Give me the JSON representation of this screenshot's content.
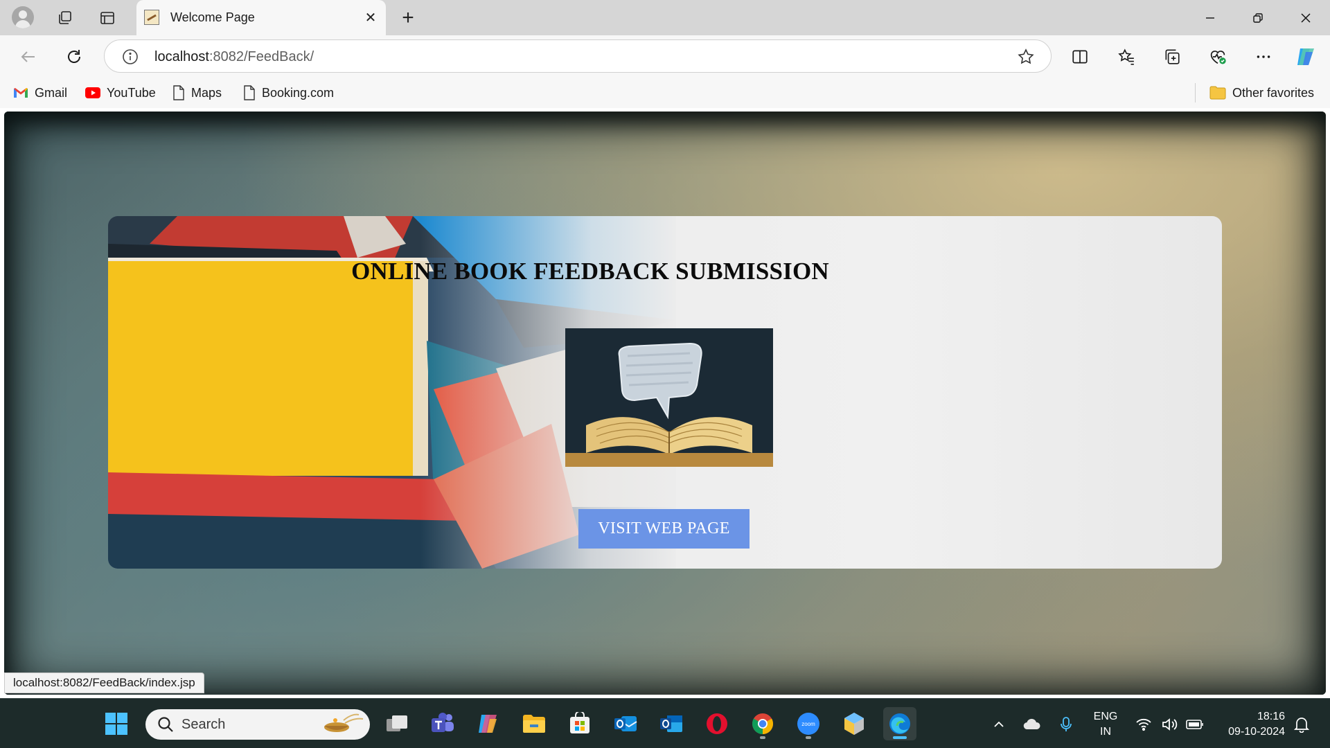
{
  "browser": {
    "tab": {
      "title": "Welcome Page"
    },
    "address": {
      "host": "localhost",
      "path": ":8082/FeedBack/"
    },
    "bookmarks": [
      {
        "label": "Gmail",
        "icon": "gmail-icon"
      },
      {
        "label": "YouTube",
        "icon": "youtube-icon"
      },
      {
        "label": "Maps",
        "icon": "page-icon"
      },
      {
        "label": "Booking.com",
        "icon": "page-icon"
      }
    ],
    "other_favorites": "Other favorites",
    "status_url": "localhost:8082/FeedBack/index.jsp"
  },
  "page": {
    "title": "ONLINE BOOK FEEDBACK SUBMISSION",
    "button_label": "VISIT WEB PAGE",
    "button_color": "#6b94e6"
  },
  "taskbar": {
    "search_label": "Search",
    "language": "ENG",
    "region": "IN",
    "time": "18:16",
    "date": "09-10-2024",
    "apps": [
      "start-icon",
      "task-view-icon",
      "teams-icon",
      "copilot-icon",
      "file-explorer-icon",
      "microsoft-store-icon",
      "outlook-new-icon",
      "outlook-icon",
      "opera-icon",
      "chrome-icon",
      "zoom-icon",
      "app-icon",
      "edge-icon"
    ]
  }
}
